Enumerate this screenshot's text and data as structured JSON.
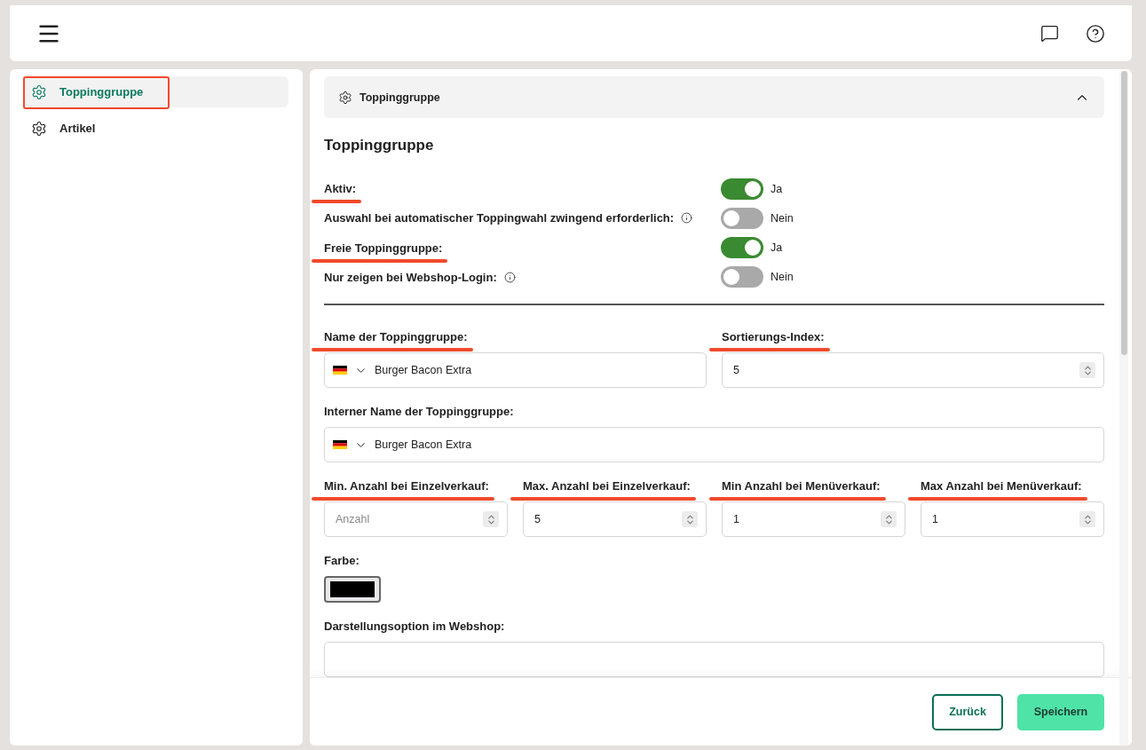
{
  "sidebar": {
    "items": [
      {
        "label": "Toppinggruppe",
        "selected": true,
        "annotated": true
      },
      {
        "label": "Artikel",
        "selected": false,
        "annotated": false
      }
    ]
  },
  "accordion": {
    "title": "Toppinggruppe",
    "expanded": true
  },
  "heading": "Toppinggruppe",
  "toggles": [
    {
      "label": "Aktiv:",
      "info": false,
      "on": true,
      "state_text": "Ja",
      "annotated": true
    },
    {
      "label": "Auswahl bei automatischer Toppingwahl zwingend erforderlich:",
      "info": true,
      "on": false,
      "state_text": "Nein",
      "annotated": false
    },
    {
      "label": "Freie Toppinggruppe:",
      "info": false,
      "on": true,
      "state_text": "Ja",
      "annotated": true
    },
    {
      "label": "Nur zeigen bei Webshop-Login:",
      "info": true,
      "on": false,
      "state_text": "Nein",
      "annotated": false
    }
  ],
  "field_rows": [
    [
      {
        "kind": "language",
        "label": "Name der Toppinggruppe:",
        "value": "Burger Bacon Extra",
        "annotated": true
      },
      {
        "kind": "number",
        "label": "Sortierungs-Index:",
        "value": "5",
        "annotated": true
      }
    ],
    [
      {
        "kind": "language",
        "label": "Interner Name der Toppinggruppe:",
        "value": "Burger Bacon Extra",
        "annotated": false
      }
    ],
    [
      {
        "kind": "number",
        "label": "Min. Anzahl bei Einzelverkauf:",
        "placeholder": "Anzahl",
        "annotated": true
      },
      {
        "kind": "number",
        "label": "Max. Anzahl bei Einzelverkauf:",
        "value": "5",
        "annotated": true
      },
      {
        "kind": "number",
        "label": "Min Anzahl bei Menüverkauf:",
        "value": "1",
        "annotated": true
      },
      {
        "kind": "number",
        "label": "Max Anzahl bei Menüverkauf:",
        "value": "1",
        "annotated": true
      }
    ],
    [
      {
        "kind": "color",
        "label": "Farbe:",
        "color": "#000000",
        "annotated": false
      }
    ],
    [
      {
        "kind": "select",
        "label": "Darstellungsoption im Webshop:",
        "annotated": false
      }
    ]
  ],
  "buttons": [
    {
      "label": "Zurück",
      "kind": "secondary"
    },
    {
      "label": "Speichern",
      "kind": "primary"
    }
  ]
}
